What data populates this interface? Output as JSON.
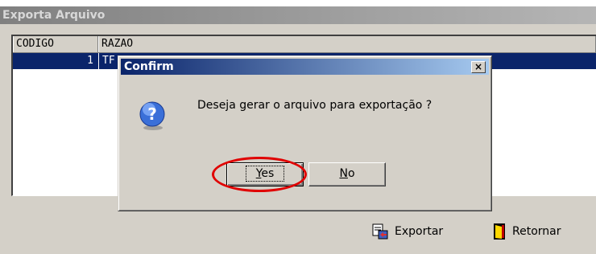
{
  "window": {
    "title": "Exporta Arquivo"
  },
  "grid": {
    "columns": [
      "CODIGO",
      "RAZAO"
    ],
    "rows": [
      {
        "codigo": "1",
        "razao": "TF"
      }
    ]
  },
  "toolbar": {
    "export_label": "Exportar",
    "return_label": "Retornar"
  },
  "dialog": {
    "title": "Confirm",
    "close_label": "×",
    "message": "Deseja gerar o arquivo para exportação ?",
    "yes_accel": "Y",
    "yes_rest": "es",
    "no_accel": "N",
    "no_rest": "o",
    "icon": "question-icon"
  },
  "colors": {
    "selection": "#0a246a",
    "highlight_circle": "#e00000"
  }
}
